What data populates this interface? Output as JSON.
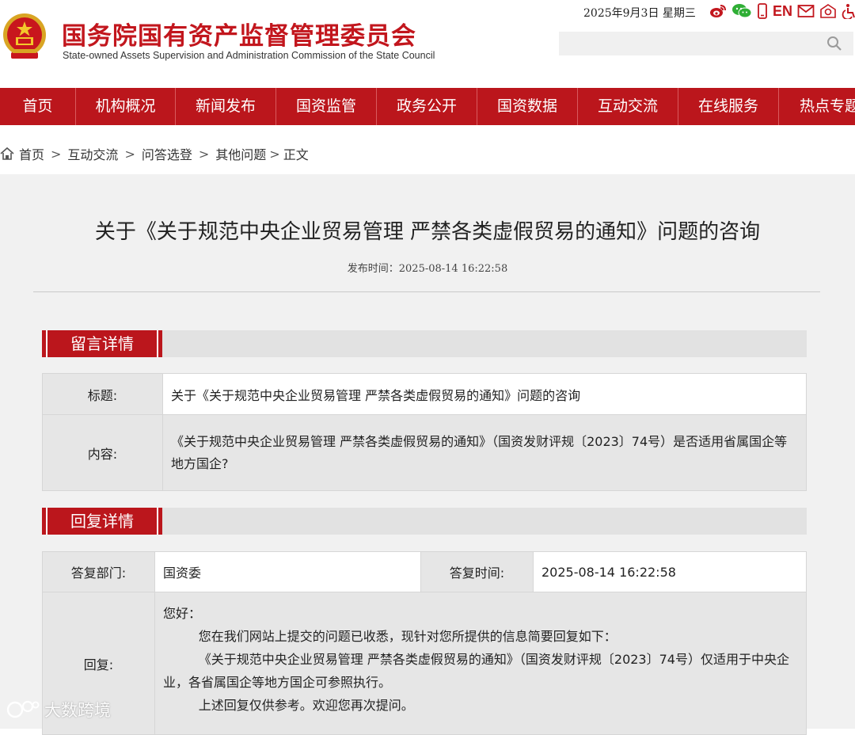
{
  "header": {
    "org_name_cn": "国务院国有资产监督管理委员会",
    "org_name_en": "State-owned Assets Supervision and Administration Commission of the State Council",
    "date": "2025年9月3日 星期三",
    "lang_link": "EN",
    "search_placeholder": ""
  },
  "nav": {
    "items": [
      "首页",
      "机构概况",
      "新闻发布",
      "国资监管",
      "政务公开",
      "国资数据",
      "互动交流",
      "在线服务",
      "热点专题"
    ]
  },
  "breadcrumb": {
    "items": [
      "首页",
      "互动交流",
      "问答选登",
      "其他问题",
      "正文"
    ]
  },
  "article": {
    "title": "关于《关于规范中央企业贸易管理 严禁各类虚假贸易的通知》问题的咨询",
    "publish_time": "发布时间：2025-08-14 16:22:58"
  },
  "message": {
    "section_label": "留言详情",
    "title_label": "标题:",
    "title_value": "关于《关于规范中央企业贸易管理 严禁各类虚假贸易的通知》问题的咨询",
    "content_label": "内容:",
    "content_value": "《关于规范中央企业贸易管理 严禁各类虚假贸易的通知》（国资发财评规〔2023〕74号）是否适用省属国企等地方国企?"
  },
  "reply": {
    "section_label": "回复详情",
    "dept_label": "答复部门:",
    "dept_value": "国资委",
    "time_label": "答复时间:",
    "time_value": "2025-08-14 16:22:58",
    "reply_label": "回复:",
    "greeting": "您好：",
    "para1": "您在我们网站上提交的问题已收悉，现针对您所提供的信息简要回复如下：",
    "para2": "《关于规范中央企业贸易管理 严禁各类虚假贸易的通知》（国资发财评规〔2023〕74号）仅适用于中央企业，各省属国企等地方国企可参照执行。",
    "para3": "上述回复仅供参考。欢迎您再次提问。"
  },
  "watermark": {
    "text": "大数跨境"
  },
  "colors": {
    "brand_red": "#bb161c",
    "title_red": "#c2161d",
    "panel_gray": "#f1f1f1"
  }
}
